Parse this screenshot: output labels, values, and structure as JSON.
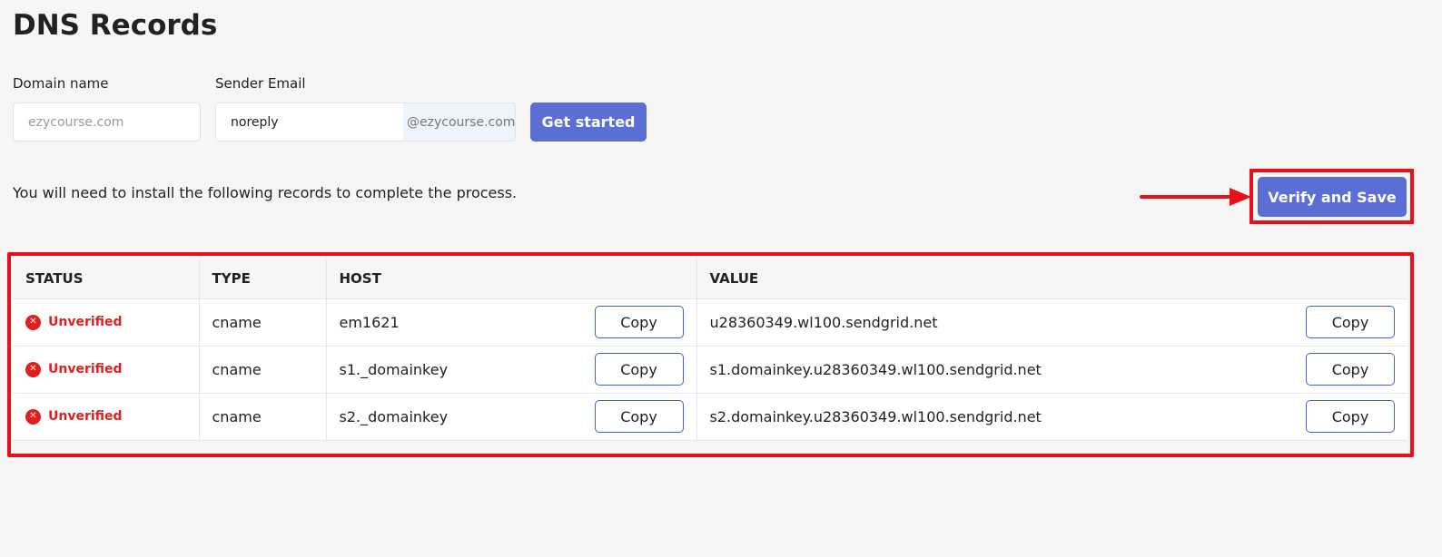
{
  "page": {
    "title": "DNS Records"
  },
  "form": {
    "domain_label": "Domain name",
    "domain_placeholder": "ezycourse.com",
    "sender_label": "Sender Email",
    "sender_value": "noreply",
    "sender_suffix": "@ezycourse.com",
    "get_started_label": "Get started"
  },
  "instruction": "You will need to install the following records to complete the process.",
  "verify_label": "Verify and Save",
  "table": {
    "headers": [
      "STATUS",
      "TYPE",
      "HOST",
      "VALUE"
    ],
    "copy_label": "Copy",
    "rows": [
      {
        "status": "Unverified",
        "type": "cname",
        "host": "em1621",
        "value": "u28360349.wl100.sendgrid.net"
      },
      {
        "status": "Unverified",
        "type": "cname",
        "host": "s1._domainkey",
        "value": "s1.domainkey.u28360349.wl100.sendgrid.net"
      },
      {
        "status": "Unverified",
        "type": "cname",
        "host": "s2._domainkey",
        "value": "s2.domainkey.u28360349.wl100.sendgrid.net"
      }
    ]
  },
  "colors": {
    "primary": "#5a6fd6",
    "error": "#e02020",
    "highlight": "#e8101a",
    "background": "#f6f6f7"
  },
  "icons": {
    "status": "x-circle-icon",
    "annotation": "arrow-right-icon"
  }
}
